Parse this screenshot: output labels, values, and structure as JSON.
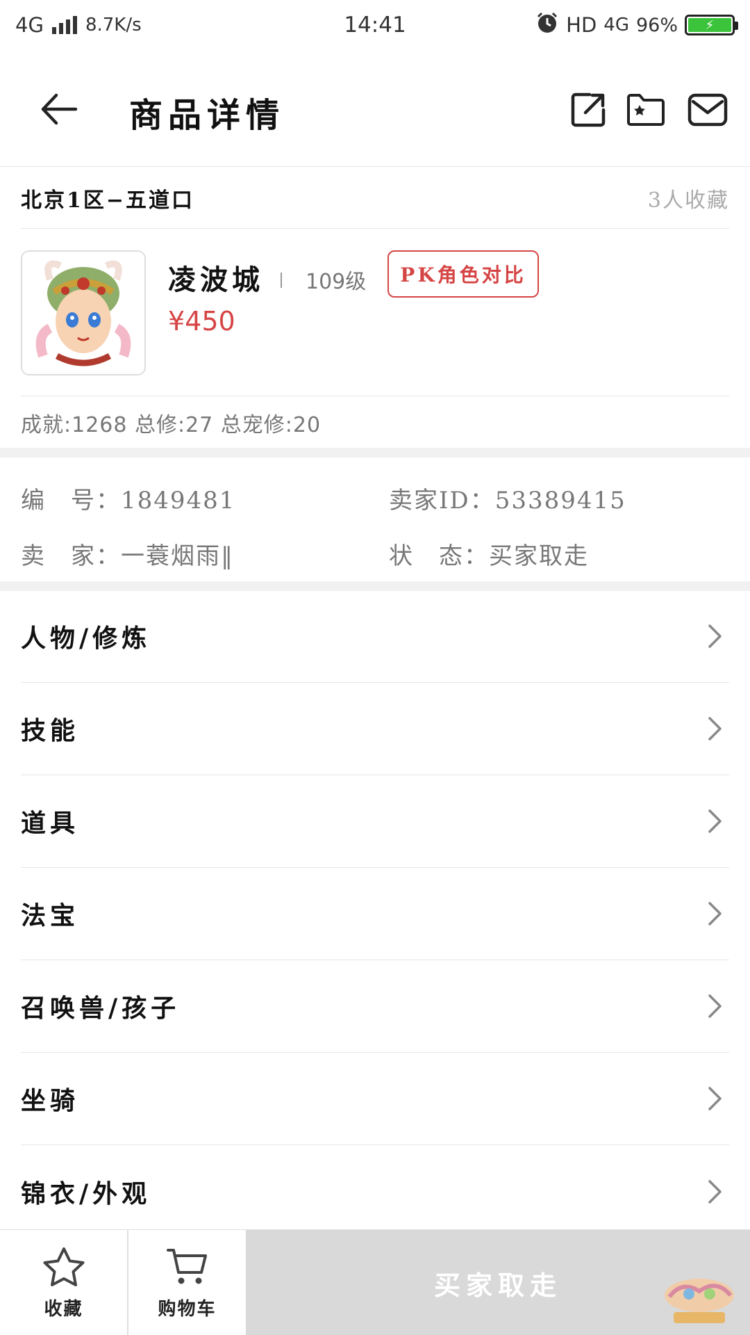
{
  "status_bar": {
    "network": "4G",
    "speed": "8.7K/s",
    "time": "14:41",
    "hd": "HD",
    "network2": "4G",
    "battery": "96%"
  },
  "header": {
    "title": "商品详情"
  },
  "region": {
    "name": "北京1区−五道口",
    "favorites": "3人收藏"
  },
  "product": {
    "name": "凌波城",
    "level": "109级",
    "pk_button": "PK角色对比",
    "price": "¥450"
  },
  "stats": "成就:1268 总修:27 总宠修:20",
  "info": {
    "number_label": "编　号：",
    "number_value": "1849481",
    "seller_id_label": "卖家ID：",
    "seller_id_value": "53389415",
    "seller_label": "卖　家：",
    "seller_value": "一蓑烟雨‖",
    "status_label": "状　态：",
    "status_value": "买家取走"
  },
  "menu": [
    {
      "label": "人物/修炼"
    },
    {
      "label": "技能"
    },
    {
      "label": "道具"
    },
    {
      "label": "法宝"
    },
    {
      "label": "召唤兽/孩子"
    },
    {
      "label": "坐骑"
    },
    {
      "label": "锦衣/外观"
    }
  ],
  "bottom": {
    "favorite_label": "收藏",
    "cart_label": "购物车",
    "buy_label": "买家取走"
  },
  "colors": {
    "accent_red": "#d64545",
    "battery_green": "#3bc43b",
    "disabled_gray": "#d9d9d9"
  },
  "icons": [
    "back-arrow-icon",
    "share-icon",
    "folder-star-icon",
    "mail-icon",
    "chevron-right-icon",
    "star-icon",
    "cart-icon"
  ]
}
